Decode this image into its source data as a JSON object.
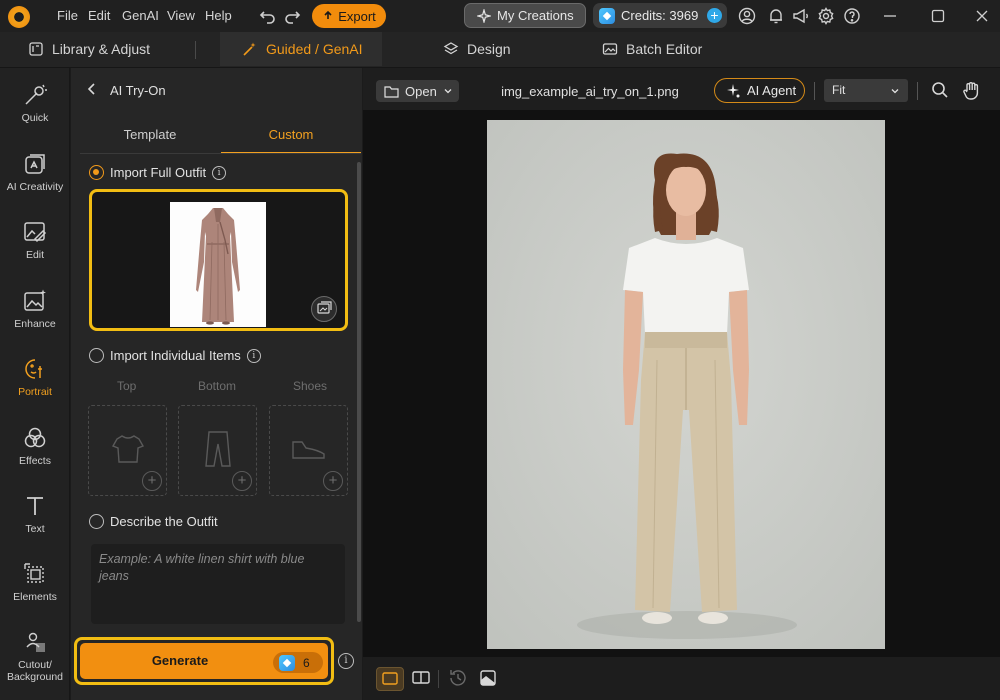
{
  "titlebar": {
    "menu": [
      "File",
      "Edit",
      "GenAI",
      "View",
      "Help"
    ],
    "export_label": "Export",
    "my_creations_label": "My Creations",
    "credits_label": "Credits: 3969"
  },
  "nav": {
    "tabs": [
      {
        "label": "Library & Adjust",
        "icon": "library-icon"
      },
      {
        "label": "Guided / GenAI",
        "icon": "magic-wand-icon"
      },
      {
        "label": "Design",
        "icon": "layers-icon"
      },
      {
        "label": "Batch Editor",
        "icon": "images-icon"
      }
    ],
    "active": "Guided / GenAI"
  },
  "rail": [
    {
      "label": "Quick",
      "icon": "magic-wand-icon"
    },
    {
      "label": "AI Creativity",
      "icon": "ai-creativity-icon"
    },
    {
      "label": "Edit",
      "icon": "edit-image-icon"
    },
    {
      "label": "Enhance",
      "icon": "enhance-image-icon"
    },
    {
      "label": "Portrait",
      "icon": "portrait-icon"
    },
    {
      "label": "Effects",
      "icon": "effects-icon"
    },
    {
      "label": "Text",
      "icon": "text-icon"
    },
    {
      "label": "Elements",
      "icon": "elements-icon"
    },
    {
      "label": "Cutout/",
      "label2": "Background",
      "icon": "cutout-icon"
    }
  ],
  "panel": {
    "title": "AI Try-On",
    "tabs": [
      "Template",
      "Custom"
    ],
    "active_tab": "Custom",
    "import_full_outfit": "Import Full Outfit",
    "import_individual": "Import Individual Items",
    "item_columns": [
      "Top",
      "Bottom",
      "Shoes"
    ],
    "describe_outfit": "Describe the Outfit",
    "describe_placeholder": "Example: A white linen shirt with blue jeans",
    "generate_label": "Generate",
    "generate_cost": "6"
  },
  "canvas": {
    "open_label": "Open",
    "filename": "img_example_ai_try_on_1.png",
    "ai_agent_label": "AI Agent",
    "zoom": "Fit"
  },
  "colors": {
    "accent": "#f28f10",
    "highlight": "#f2bd13",
    "background": "#1b1b1b"
  }
}
